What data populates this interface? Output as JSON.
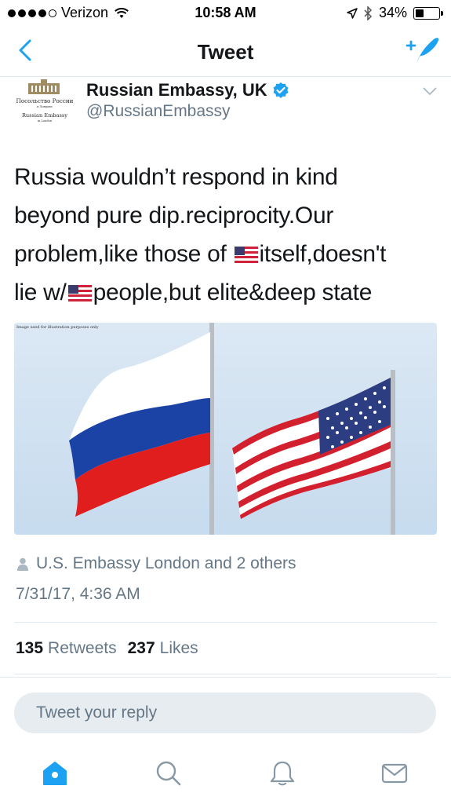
{
  "status_bar": {
    "carrier": "Verizon",
    "time": "10:58 AM",
    "battery": "34%",
    "battery_level": 0.34
  },
  "nav": {
    "title": "Tweet",
    "back_icon": "chevron-left-icon",
    "compose_icon": "compose-tweet-icon"
  },
  "tweet": {
    "author_name": "Russian Embassy, UK",
    "author_handle": "@RussianEmbassy",
    "avatar_text": {
      "line1": "Посольство России",
      "line2": "в Лондоне",
      "line3": "Russian Embassy",
      "line4": "in London"
    },
    "text_lines": [
      "Russia wouldn’t respond in kind",
      "beyond pure dip.reciprocity.Our",
      "problem,like those of ",
      "itself,doesn't",
      "lie w/",
      "people,but elite&deep state"
    ],
    "media_caption": "Image used for illustration purposes only",
    "liked_by": "U.S. Embassy London and 2 others",
    "timestamp": "7/31/17, 4:36 AM",
    "retweets_count": "135",
    "retweets_label": "Retweets",
    "likes_count": "237",
    "likes_label": "Likes"
  },
  "reply": {
    "placeholder": "Tweet your reply"
  },
  "tabs": [
    {
      "icon": "home-icon",
      "active": true
    },
    {
      "icon": "search-icon",
      "active": false
    },
    {
      "icon": "notifications-icon",
      "active": false
    },
    {
      "icon": "messages-icon",
      "active": false
    }
  ],
  "colors": {
    "twitter_blue": "#1da1f2",
    "text_primary": "#14171a",
    "text_secondary": "#657786",
    "divider": "#e1e8ed",
    "reply_bg": "#e6ecf0"
  }
}
